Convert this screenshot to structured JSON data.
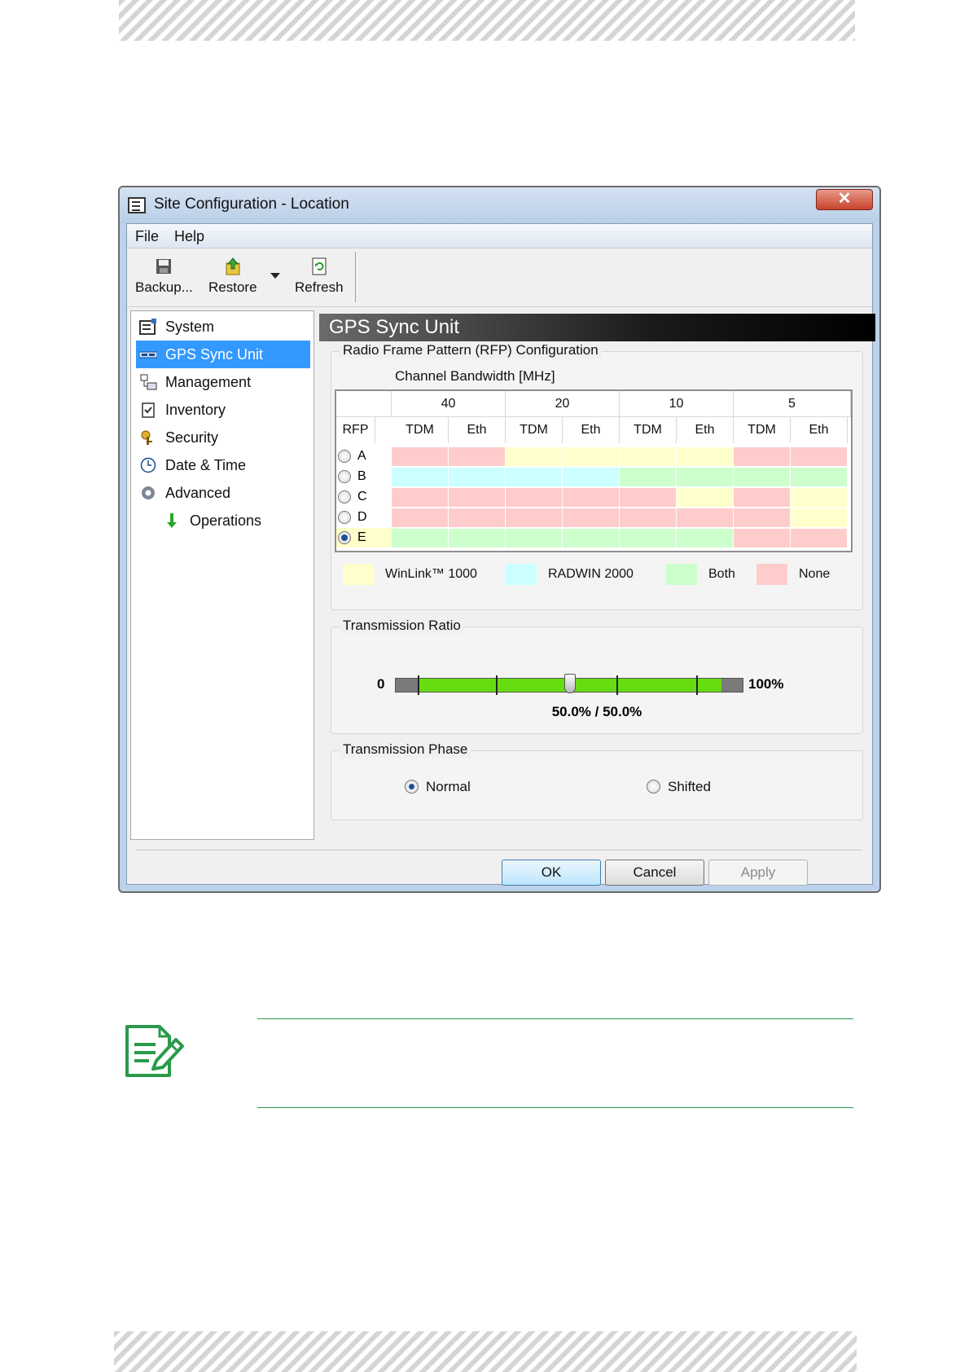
{
  "window": {
    "title": "Site Configuration - Location",
    "close_glyph": "✕"
  },
  "menu": [
    "File",
    "Help"
  ],
  "toolbar": {
    "backup": "Backup...",
    "restore": "Restore",
    "refresh": "Refresh"
  },
  "tree": {
    "items": [
      {
        "label": "System",
        "icon": "system-icon"
      },
      {
        "label": "GPS Sync Unit",
        "icon": "gps-icon",
        "selected": true
      },
      {
        "label": "Management",
        "icon": "management-icon"
      },
      {
        "label": "Inventory",
        "icon": "inventory-icon"
      },
      {
        "label": "Security",
        "icon": "security-icon"
      },
      {
        "label": "Date & Time",
        "icon": "clock-icon"
      },
      {
        "label": "Advanced",
        "icon": "gear-icon"
      }
    ],
    "sub_item": {
      "label": "Operations",
      "icon": "arrow-down-icon"
    }
  },
  "panel": {
    "title": "GPS Sync Unit",
    "rfp": {
      "group_title": "Radio Frame Pattern (RFP) Configuration",
      "bandwidth_label": "Channel Bandwidth [MHz]",
      "bandwidths": [
        "40",
        "20",
        "10",
        "5"
      ],
      "rfp_header": "RFP",
      "columns": [
        "TDM",
        "Eth",
        "TDM",
        "Eth",
        "TDM",
        "Eth",
        "TDM",
        "Eth"
      ],
      "rows": [
        {
          "label": "A",
          "selected": false,
          "cells": [
            "none",
            "none",
            "winlink",
            "winlink",
            "winlink",
            "winlink",
            "none",
            "none"
          ]
        },
        {
          "label": "B",
          "selected": false,
          "cells": [
            "radwin",
            "radwin",
            "radwin",
            "radwin",
            "both",
            "both",
            "both",
            "both"
          ]
        },
        {
          "label": "C",
          "selected": false,
          "cells": [
            "none",
            "none",
            "none",
            "none",
            "none",
            "winlink",
            "none",
            "winlink"
          ]
        },
        {
          "label": "D",
          "selected": false,
          "cells": [
            "none",
            "none",
            "none",
            "none",
            "none",
            "none",
            "none",
            "winlink"
          ]
        },
        {
          "label": "E",
          "selected": true,
          "cells": [
            "both",
            "both",
            "both",
            "both",
            "both",
            "both",
            "none",
            "none"
          ]
        }
      ],
      "colors": {
        "winlink": "#ffffcc",
        "radwin": "#ccffff",
        "both": "#ccffcc",
        "none": "#ffcccc"
      },
      "legend": [
        {
          "key": "winlink",
          "label": "WinLink™ 1000"
        },
        {
          "key": "radwin",
          "label": "RADWIN 2000"
        },
        {
          "key": "both",
          "label": "Both"
        },
        {
          "key": "none",
          "label": "None"
        }
      ]
    },
    "ratio": {
      "group_title": "Transmission Ratio",
      "min_label": "0",
      "max_label": "100%",
      "value_label": "50.0% / 50.0%",
      "value_fraction": 0.5,
      "fill_start_fraction": 0.065,
      "fill_end_fraction": 0.935,
      "tick_fractions": [
        0.065,
        0.29,
        0.5,
        0.635,
        0.865
      ],
      "accent_color": "#66dd11"
    },
    "phase": {
      "group_title": "Transmission Phase",
      "options": [
        {
          "label": "Normal",
          "checked": true
        },
        {
          "label": "Shifted",
          "checked": false
        }
      ]
    }
  },
  "buttons": {
    "ok": "OK",
    "cancel": "Cancel",
    "apply": "Apply"
  }
}
